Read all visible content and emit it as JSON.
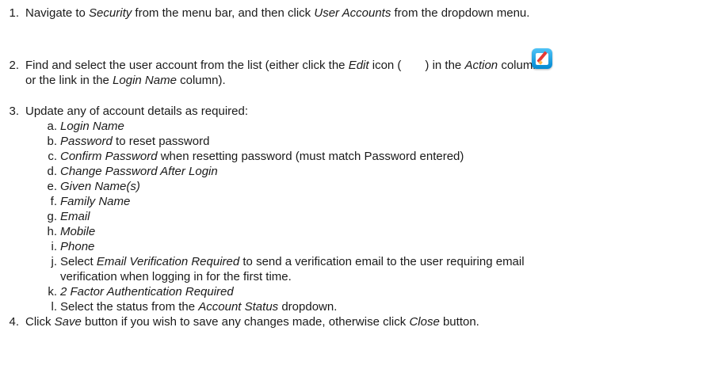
{
  "steps": {
    "s1": {
      "num": "1.",
      "a": "Navigate to ",
      "b": "Security",
      "c": " from the menu bar, and then click ",
      "d": "User Accounts",
      "e": " from the dropdown menu."
    },
    "s2": {
      "num": "2.",
      "l1a": "Find and select the user account from the list (either click the ",
      "l1b": "Edit",
      "l1c": " icon (",
      "l1d": ") in the ",
      "l1e": "Action",
      "l1f": " column",
      "l2a": "or the link in the ",
      "l2b": "Login Name",
      "l2c": " column)."
    },
    "s3": {
      "num": "3.",
      "text": "Update any of account details as required:",
      "items": [
        {
          "letter": "a.",
          "i": "Login Name",
          "t": ""
        },
        {
          "letter": "b.",
          "i": "Password",
          "t": " to reset password"
        },
        {
          "letter": "c.",
          "i": "Confirm Password",
          "t": " when resetting password (must match Password entered)"
        },
        {
          "letter": "d.",
          "i": "Change Password After Login",
          "t": ""
        },
        {
          "letter": "e.",
          "i": "Given Name(s)",
          "t": ""
        },
        {
          "letter": "f.",
          "i": "Family Name",
          "t": ""
        },
        {
          "letter": "g.",
          "i": "Email",
          "t": ""
        },
        {
          "letter": "h.",
          "i": "Mobile",
          "t": ""
        },
        {
          "letter": "i.",
          "i": "Phone",
          "t": ""
        }
      ],
      "j": {
        "letter": "j.",
        "a": "Select ",
        "b": "Email Verification Required",
        "c": " to send a verification email to the user requiring email",
        "d": "verification when logging in for the first time."
      },
      "k": {
        "letter": "k.",
        "i": "2 Factor Authentication Required"
      },
      "l": {
        "letter": "l.",
        "a": "Select the status from the ",
        "b": "Account Status",
        "c": " dropdown."
      }
    },
    "s4": {
      "num": "4.",
      "a": "Click ",
      "b": "Save",
      "c": " button if you wish to save any changes made, otherwise click ",
      "d": "Close",
      "e": " button."
    }
  },
  "icons": {
    "edit": "edit-icon"
  }
}
